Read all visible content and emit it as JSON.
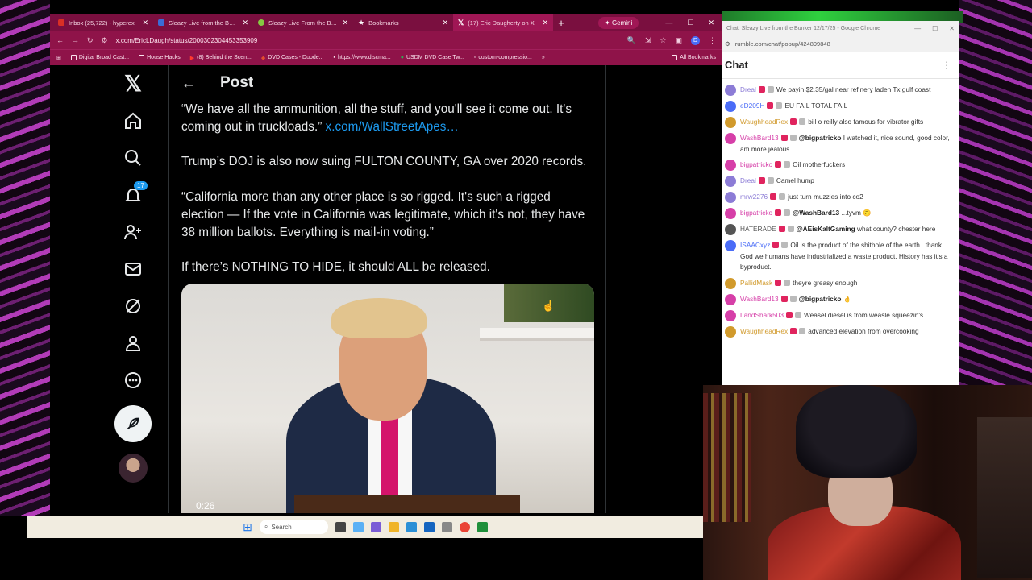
{
  "browser": {
    "tabs": [
      {
        "label": "Inbox (25,722) - hyperex",
        "color": "#d93025"
      },
      {
        "label": "Sleazy Live from the Bunk",
        "color": "#3b6cd6"
      },
      {
        "label": "Sleazy Live From the Bunk",
        "color": "#85c742"
      },
      {
        "label": "Bookmarks",
        "color": "#ffffff"
      },
      {
        "label": "(17) Eric Daugherty on X",
        "color": "#000000"
      }
    ],
    "gemini_label": "Gemini",
    "url": "x.com/EricLDaugh/status/2000302304453353909",
    "bookmarks": [
      "Digital Broad Cast...",
      "House Hacks",
      "(8) Behind the Scen...",
      "DVD Cases - Duode...",
      "https://www.discma...",
      "USDM DVD Case Tw...",
      "custom-compressio..."
    ],
    "all_bookmarks": "All Bookmarks"
  },
  "x": {
    "notifications_badge": "17",
    "page_title": "Post",
    "tweet": {
      "p1": "“We have all the ammunition, all the stuff, and you'll see it come out. It's coming out in truckloads.”",
      "p1_link": "x.com/WallStreetApes…",
      "p2": "Trump’s DOJ is also now suing FULTON COUNTY, GA over 2020 records.",
      "p3": "“California more than any other place is so rigged. It's such a rigged election — If the vote in California was legitimate, which it's not, they have 38 million ballots. Everything is mail-in voting.”",
      "p4": "If there’s NOTHING TO HIDE, it should ALL be released."
    },
    "video_time": "0:26"
  },
  "taskbar": {
    "search_placeholder": "Search"
  },
  "chat": {
    "window_title": "Chat: Sleazy Live from the Bunker 12/17/25 - Google Chrome",
    "url": "rumble.com/chat/popup/424899848",
    "title": "Chat",
    "messages": [
      {
        "user": "Dreal",
        "user_color": "#8c7cd6",
        "text": "We payin $2.35/gal near refinery laden Tx gulf coast",
        "mention": ""
      },
      {
        "user": "eD209H",
        "user_color": "#4a6cf7",
        "text": "EU FAIL TOTAL FAIL",
        "mention": ""
      },
      {
        "user": "WaughheadRex",
        "user_color": "#d19a2c",
        "text": "bill o reilly also famous for vibrator gifts",
        "mention": ""
      },
      {
        "user": "WashBard13",
        "user_color": "#d63fa8",
        "text": "I watched it, nice sound, good color, am more jealous",
        "mention": "@bigpatricko"
      },
      {
        "user": "bigpatricko",
        "user_color": "#d63fa8",
        "text": "Oil motherfuckers",
        "mention": ""
      },
      {
        "user": "Dreal",
        "user_color": "#8c7cd6",
        "text": "Camel hump",
        "mention": ""
      },
      {
        "user": "mrw2276",
        "user_color": "#8c7cd6",
        "text": "just turn muzzies into co2",
        "mention": ""
      },
      {
        "user": "bigpatricko",
        "user_color": "#d63fa8",
        "text": "...tyvm 🙃",
        "mention": "@WashBard13"
      },
      {
        "user": "HATERADE",
        "user_color": "#555555",
        "text": "what county? chester here",
        "mention": "@AEisKaltGaming"
      },
      {
        "user": "ISAACxyz",
        "user_color": "#4a6cf7",
        "text": "Oil is the product of the shithole of the earth...thank God we humans have industrialized a waste product. History has it's a byproduct.",
        "mention": ""
      },
      {
        "user": "PallidMask",
        "user_color": "#d19a2c",
        "text": "theyre greasy enough",
        "mention": ""
      },
      {
        "user": "WashBard13",
        "user_color": "#d63fa8",
        "text": "👌",
        "mention": "@bigpatricko"
      },
      {
        "user": "LandShark503",
        "user_color": "#d63fa8",
        "text": "Weasel diesel is from weasle squeezin's",
        "mention": ""
      },
      {
        "user": "WaughheadRex",
        "user_color": "#d19a2c",
        "text": "advanced elevation from overcooking",
        "mention": ""
      }
    ]
  }
}
